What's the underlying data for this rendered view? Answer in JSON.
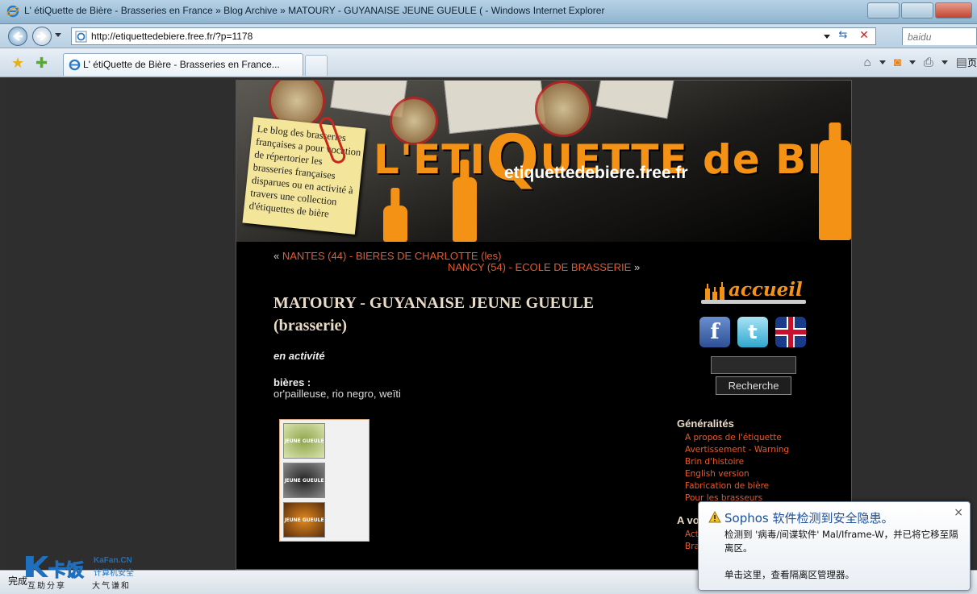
{
  "window": {
    "title": "L'  étiQuette de Bière - Brasseries en France » Blog Archive » MATOURY - GUYANAISE JEUNE GUEULE ( - Windows Internet Explorer"
  },
  "address": {
    "url": "http://etiquettedebiere.free.fr/?p=1178",
    "search_placeholder": "baidu"
  },
  "tab": {
    "label": "L'  étiQuette de Bière - Brasseries en France..."
  },
  "commandbar": {
    "page_label": "页"
  },
  "header": {
    "note_text": "Le blog des brasseries françaises a pour vocation de répertorier les brasseries françaises disparues ou en activité à travers une collection d'étiquettes de bière",
    "title_part1": "L'ETI",
    "title_q": "Q",
    "title_part2": "UETTE de BIERE",
    "subtitle": "etiquettedebiere.free.fr"
  },
  "postnav": {
    "prev_prefix": "« ",
    "prev_link": "NANTES (44) - BIERES DE CHARLOTTE (les)",
    "next_link": "NANCY (54) - ECOLE DE BRASSERIE",
    "next_suffix": " »"
  },
  "post": {
    "title": "MATOURY - GUYANAISE JEUNE GUEULE (brasserie)",
    "status": "en activité",
    "beers_heading": "bières :",
    "beers": "or'pailleuse, rio negro, weïti",
    "label_text": "JEUNE GUEULE"
  },
  "sidebar": {
    "accueil": "accueil",
    "search_button": "Recherche",
    "section1_title": "Généralités",
    "section1_items": [
      "A propos de l'étiquette",
      "Avertissement - Warning",
      "Brin d'histoire",
      "English version",
      "Fabrication de bière",
      "Pour les brasseurs"
    ],
    "section2_title": "A vo",
    "section2_items": [
      "Act",
      "Bra"
    ]
  },
  "statusbar": {
    "text": "完成"
  },
  "watermark": {
    "cn": "卡饭",
    "site": "KaFan.CN",
    "sec": "计算机安全",
    "slogan1": "互助分享",
    "slogan2": "大气谦和"
  },
  "popup": {
    "title": "Sophos 软件检测到安全隐患。",
    "body": "检测到 '病毒/间谍软件' Mal/Iframe-W，并已将它移至隔离区。",
    "link": "单击这里，查看隔离区管理器。",
    "close": "×"
  }
}
